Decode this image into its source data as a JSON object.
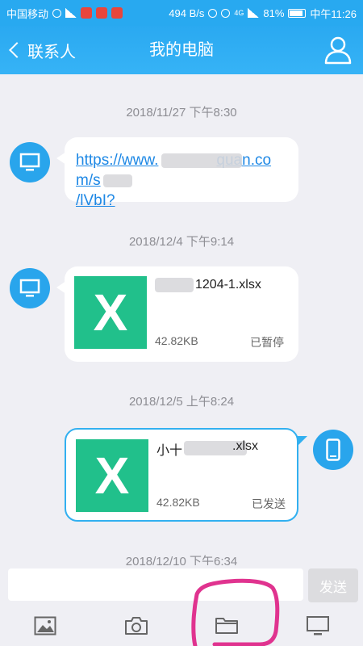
{
  "status_bar": {
    "carrier": "中国移动",
    "speed": "494 B/s",
    "network": "4G",
    "battery": "81%",
    "time": "中午11:26"
  },
  "header": {
    "back_label": "联系人",
    "title": "我的电脑",
    "profile_icon": "person-icon"
  },
  "messages": [
    {
      "timestamp": "2018/11/27 下午8:30",
      "link_line1": "https://www.",
      "link_line1_end": "quan.com/s",
      "link_line2": "/lVbI?",
      "avatar_icon": "computer-icon"
    },
    {
      "timestamp": "2018/12/4 下午9:14",
      "file_name": "1204-1.xlsx",
      "file_size": "42.82KB",
      "status": "已暂停",
      "thumb_letter": "X",
      "avatar_icon": "computer-icon"
    },
    {
      "timestamp": "2018/12/5 上午8:24",
      "file_name_start": "小十",
      "file_name_end": ".xlsx",
      "file_size": "42.82KB",
      "status": "已发送",
      "thumb_letter": "X",
      "avatar_icon": "phone-icon"
    },
    {
      "timestamp": "2018/12/10 下午6:34"
    }
  ],
  "composer": {
    "input_value": "",
    "send_label": "发送"
  },
  "toolbar": {
    "items": [
      "image-icon",
      "camera-icon",
      "folder-icon",
      "computer-icon"
    ]
  },
  "colors": {
    "accent": "#2aa9f1",
    "excel_green": "#21c08b",
    "annotation": "#e0338f"
  }
}
